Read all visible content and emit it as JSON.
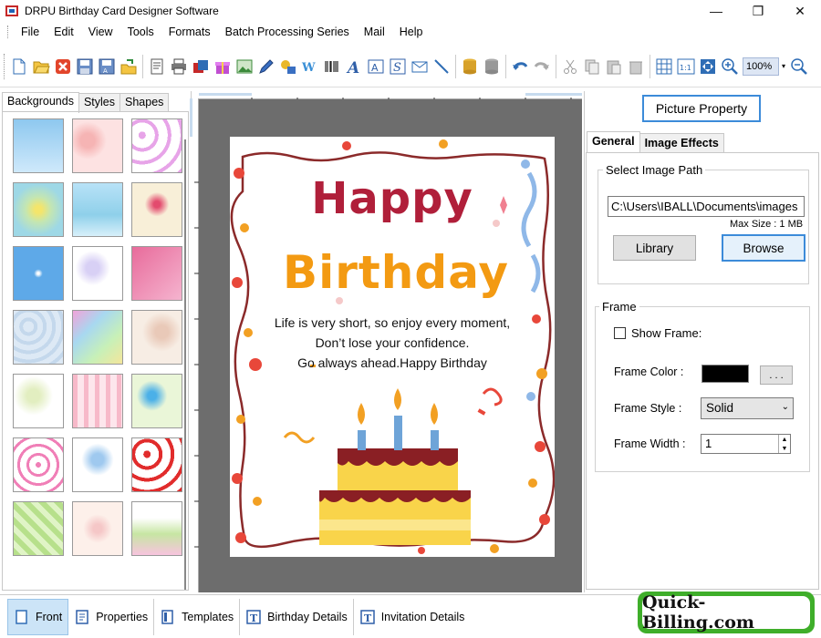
{
  "window": {
    "title": "DRPU Birthday Card Designer Software",
    "minimize": "—",
    "maximize": "❐",
    "close": "✕"
  },
  "menu": [
    "File",
    "Edit",
    "View",
    "Tools",
    "Formats",
    "Batch Processing Series",
    "Mail",
    "Help"
  ],
  "toolbar": {
    "zoom": "100%",
    "zoom_dropdown": "▾"
  },
  "left_panel": {
    "tabs": [
      "Backgrounds",
      "Styles",
      "Shapes"
    ],
    "active_tab": "Backgrounds"
  },
  "card": {
    "line1": "Happy",
    "line2": "Birthday",
    "message": [
      "Life is very short, so enjoy every moment,",
      "Don’t lose your confidence.",
      "Go always ahead.Happy Birthday"
    ],
    "colors": {
      "happy": "#b01f3a",
      "birthday": "#f39a12"
    }
  },
  "right_panel": {
    "picture_property": "Picture Property",
    "tabs": [
      "General",
      "Image Effects"
    ],
    "image_path_group": "Select Image Path",
    "image_path": "C:\\Users\\IBALL\\Documents\\images",
    "max_size": "Max Size : 1 MB",
    "library": "Library",
    "browse": "Browse",
    "frame_group": "Frame",
    "show_frame": "Show Frame:",
    "frame_color_label": "Frame Color :",
    "frame_color_btn": ". . .",
    "frame_style_label": "Frame Style :",
    "frame_style_value": "Solid",
    "frame_width_label": "Frame Width :",
    "frame_width_value": "1"
  },
  "bottom": {
    "items": [
      "Front",
      "Properties",
      "Templates",
      "Birthday Details",
      "Invitation Details"
    ],
    "logo": "Quick-Billing.com"
  }
}
